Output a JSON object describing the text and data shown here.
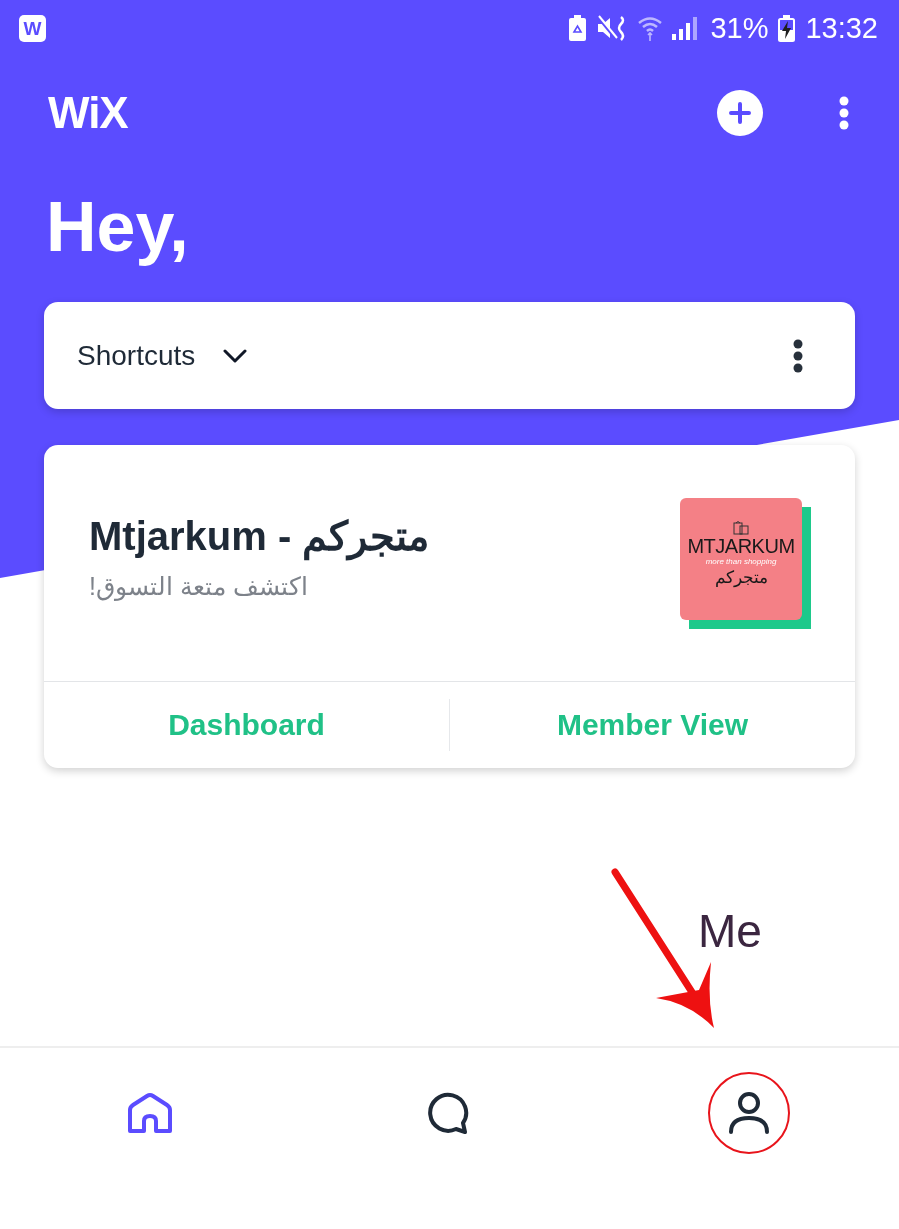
{
  "status_bar": {
    "app_badge": "W",
    "battery_percent": "31%",
    "time": "13:32"
  },
  "header": {
    "logo": "WiX",
    "greeting": "Hey,"
  },
  "shortcuts": {
    "label": "Shortcuts",
    "expanded": false
  },
  "site_card": {
    "title": "Mtjarkum - متجركم",
    "subtitle": "اكتشف متعة التسوق!",
    "thumbnail": {
      "wordmark": "MTJARKUM",
      "tagline": "more than shopping",
      "wordmark_arabic": "متجركم"
    },
    "actions": [
      "Dashboard",
      "Member View"
    ]
  },
  "bottom_nav": [
    {
      "kind": "home",
      "selected": true,
      "annotated": false
    },
    {
      "kind": "chat",
      "selected": false,
      "annotated": false
    },
    {
      "kind": "profile",
      "selected": false,
      "annotated": true
    }
  ],
  "annotation": {
    "label": "Me"
  }
}
